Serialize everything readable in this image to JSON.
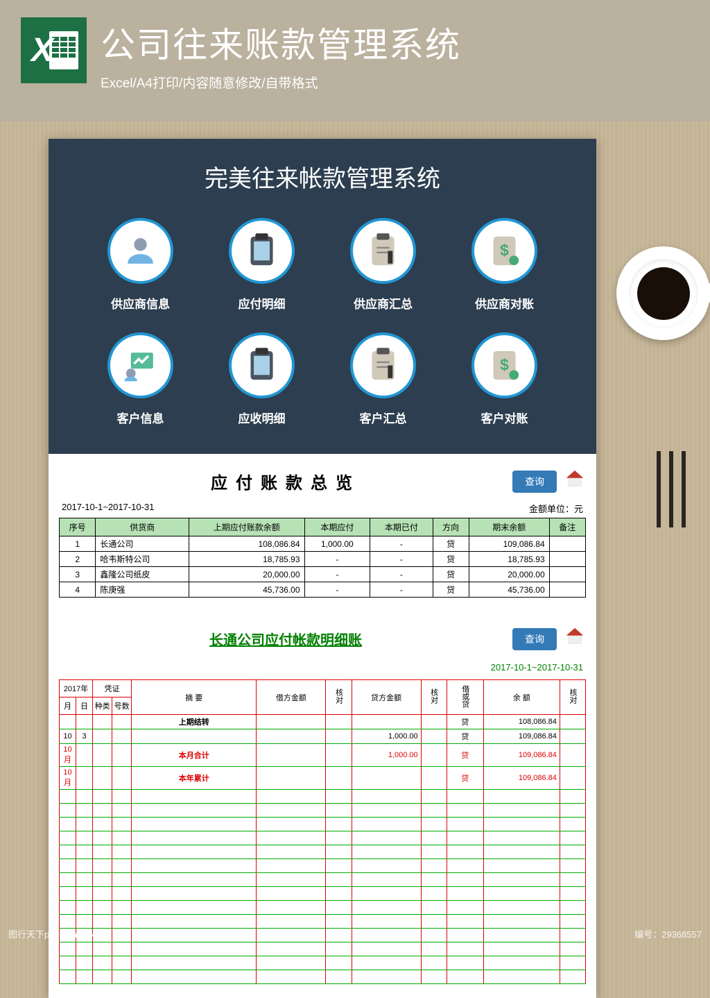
{
  "header": {
    "title": "公司往来账款管理系统",
    "subtitle": "Excel/A4打印/内容随意修改/自带格式",
    "excel_letter": "X"
  },
  "system": {
    "title": "完美往来帐款管理系统",
    "modules_row1": [
      {
        "label": "供应商信息",
        "icon": "user-icon"
      },
      {
        "label": "应付明细",
        "icon": "clipboard-icon"
      },
      {
        "label": "供应商汇总",
        "icon": "report-icon"
      },
      {
        "label": "供应商对账",
        "icon": "money-icon"
      }
    ],
    "modules_row2": [
      {
        "label": "客户信息",
        "icon": "chart-user-icon"
      },
      {
        "label": "应收明细",
        "icon": "clipboard-icon"
      },
      {
        "label": "客户汇总",
        "icon": "report-icon"
      },
      {
        "label": "客户对账",
        "icon": "money-icon"
      }
    ]
  },
  "summary": {
    "title": "应付账款总览",
    "date_range": "2017-10-1~2017-10-31",
    "unit": "金额单位：元",
    "query_btn": "查询",
    "headers": [
      "序号",
      "供货商",
      "上期应付账款余额",
      "本期应付",
      "本期已付",
      "方向",
      "期末余额",
      "备注"
    ],
    "rows": [
      {
        "no": "1",
        "supplier": "长通公司",
        "prev": "108,086.84",
        "due": "1,000.00",
        "paid": "-",
        "dir": "贷",
        "end": "109,086.84",
        "note": ""
      },
      {
        "no": "2",
        "supplier": "哈韦斯特公司",
        "prev": "18,785.93",
        "due": "-",
        "paid": "-",
        "dir": "贷",
        "end": "18,785.93",
        "note": ""
      },
      {
        "no": "3",
        "supplier": "鑫隆公司纸皮",
        "prev": "20,000.00",
        "due": "-",
        "paid": "-",
        "dir": "贷",
        "end": "20,000.00",
        "note": ""
      },
      {
        "no": "4",
        "supplier": "陈庚强",
        "prev": "45,736.00",
        "due": "-",
        "paid": "-",
        "dir": "贷",
        "end": "45,736.00",
        "note": ""
      }
    ]
  },
  "ledger": {
    "title": "长通公司应付帐款明细账",
    "query_btn": "查询",
    "date_range": "2017-10-1~2017-10-31",
    "year": "2017年",
    "headers": {
      "month": "月",
      "day": "日",
      "voucher": "凭证",
      "type": "种类",
      "no": "号数",
      "summary": "摘 要",
      "debit": "借方金额",
      "credit": "贷方金额",
      "dir": "借或贷",
      "balance": "余 额",
      "check": "核对"
    },
    "rows": [
      {
        "summary": "上期结转",
        "dir": "贷",
        "balance": "108,086.84",
        "bold": true
      },
      {
        "month": "10",
        "day": "3",
        "credit": "1,000.00",
        "dir": "贷",
        "balance": "109,086.84"
      },
      {
        "month": "10月",
        "summary": "本月合计",
        "credit": "1,000.00",
        "dir": "贷",
        "balance": "109,086.84",
        "red": true,
        "bold": true
      },
      {
        "month": "10月",
        "summary": "本年累计",
        "dir": "贷",
        "balance": "109,086.84",
        "red": true,
        "bold": true
      }
    ]
  },
  "watermark": {
    "left": "图行天下photophoto.cn",
    "right": "编号：29368557"
  }
}
